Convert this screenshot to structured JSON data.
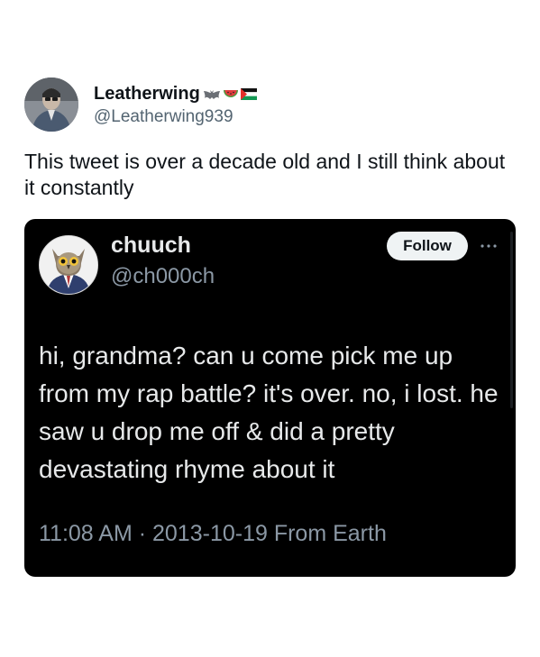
{
  "outer_tweet": {
    "display_name": "Leatherwing",
    "badges": [
      "bat-emoji-icon",
      "watermelon-emoji-icon",
      "palestine-flag-icon"
    ],
    "handle": "@Leatherwing939",
    "text": "This tweet is over a decade old and I still think about it constantly"
  },
  "quoted_tweet": {
    "display_name": "chuuch",
    "handle": "@ch000ch",
    "follow_label": "Follow",
    "text": "hi, grandma? can u come pick me up from my rap battle? it's over. no, i lost. he saw u drop me off & did a pretty devastating rhyme about it",
    "time": "11:08 AM",
    "separator": " · ",
    "date": "2013-10-19",
    "source": " From Earth"
  },
  "colors": {
    "card_background": "#000000",
    "card_text": "#e7e9ea",
    "card_secondary": "#8b98a5",
    "follow_bg": "#eff3f4",
    "handle_gray": "#536471"
  }
}
